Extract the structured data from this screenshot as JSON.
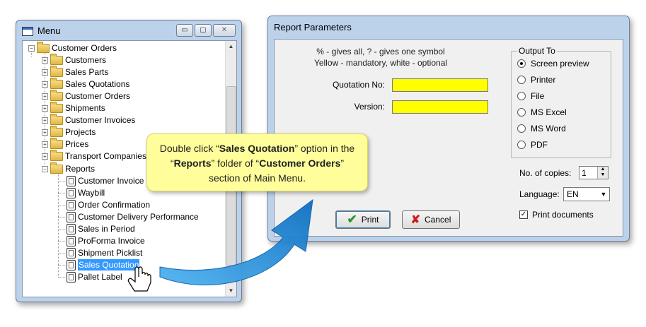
{
  "menu_window": {
    "title": "Menu",
    "controls": {
      "minimize": "▭",
      "maximize": "▢",
      "close": "✕"
    },
    "tree": {
      "root": "Customer Orders",
      "folders": [
        "Customers",
        "Sales Parts",
        "Sales Quotations",
        "Customer Orders",
        "Shipments",
        "Customer Invoices",
        "Projects",
        "Prices",
        "Transport Companies"
      ],
      "reports_folder": "Reports",
      "reports": [
        "Customer Invoice",
        "Waybill",
        "Order Confirmation",
        "Customer Delivery Performance",
        "Sales in Period",
        "ProForma Invoice",
        "Shipment Picklist",
        "Sales Quotation",
        "Pallet Label"
      ],
      "selected": "Sales Quotation"
    }
  },
  "report_window": {
    "title": "Report Parameters",
    "hint_line1": "% - gives all, ? - gives one symbol",
    "hint_line2": "Yellow - mandatory, white - optional",
    "quotation_label": "Quotation No:",
    "version_label": "Version:",
    "output_group": "Output To",
    "output_options": [
      "Screen preview",
      "Printer",
      "File",
      "MS Excel",
      "MS Word",
      "PDF"
    ],
    "selected_output": "Screen preview",
    "copies_label": "No. of copies:",
    "copies_value": "1",
    "language_label": "Language:",
    "language_value": "EN",
    "print_documents_label": "Print documents",
    "print_documents_checked": true,
    "print_button": "Print",
    "cancel_button": "Cancel"
  },
  "callout": {
    "t1": "Double click “",
    "b1": "Sales Quotation",
    "t2": "” option in the “",
    "b2": "Reports",
    "t3": "” folder of “",
    "b3": "Customer Orders",
    "t4": "” section of Main Menu."
  },
  "colors": {
    "window_frame": "#bcd1ea",
    "mandatory_field": "#ffff00",
    "selection": "#3399ff",
    "callout_bg": "#fffe9b",
    "arrow": "#1f8fd8"
  }
}
